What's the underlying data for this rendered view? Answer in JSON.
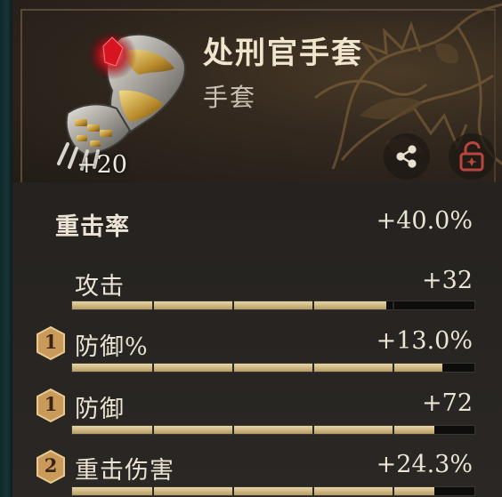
{
  "item": {
    "name": "处刑官手套",
    "type": "手套",
    "level": "+20"
  },
  "icons": {
    "share": "share-icon",
    "lock": "unlocked-padlock-icon"
  },
  "colors": {
    "gold_bar": "#d9c493",
    "text": "#ebe4d4",
    "badge": "#c99a5a"
  },
  "stats": {
    "main": {
      "label": "重击率",
      "value": "+40.0%"
    },
    "substats": [
      {
        "label": "攻击",
        "value": "+32",
        "upgrades": null,
        "fill_fraction": 0.78
      },
      {
        "label": "防御%",
        "value": "+13.0%",
        "upgrades": "1",
        "fill_fraction": 0.92
      },
      {
        "label": "防御",
        "value": "+72",
        "upgrades": "1",
        "fill_fraction": 0.9
      },
      {
        "label": "重击伤害",
        "value": "+24.3%",
        "upgrades": "2",
        "fill_fraction": 0.9
      }
    ]
  }
}
